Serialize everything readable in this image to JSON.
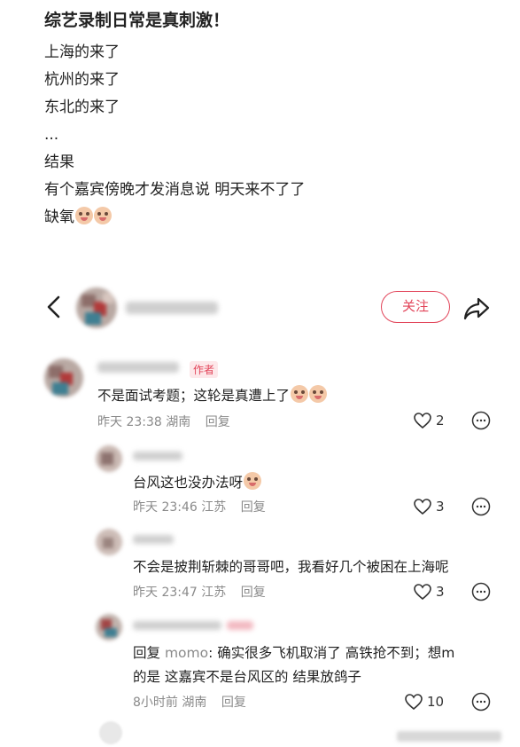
{
  "post": {
    "title": "综艺录制日常是真刺激！",
    "lines": [
      "上海的来了",
      "杭州的来了",
      "东北的来了",
      "...",
      "结果",
      "有个嘉宾傍晚才发消息说 明天来不了了",
      "缺氧"
    ]
  },
  "author_bar": {
    "follow_label": "关注"
  },
  "comments": [
    {
      "author_tag": "作者",
      "text": "不是面试考题；这轮是真遭上了",
      "time": "昨天 23:38",
      "location": "湖南",
      "reply": "回复",
      "likes": "2"
    },
    {
      "text": "台风这也没办法呀",
      "time": "昨天 23:46",
      "location": "江苏",
      "reply": "回复",
      "likes": "3"
    },
    {
      "text": "不会是披荆斩棘的哥哥吧，我看好几个被困在上海呢",
      "time": "昨天 23:47",
      "location": "江苏",
      "reply": "回复",
      "likes": "3"
    },
    {
      "reply_prefix": "回复",
      "mention": "momo",
      "text_line1": ": 确实很多飞机取消了 高铁抢不到；想m",
      "text_line2": "的是 这嘉宾不是台风区的 结果放鸽子",
      "time": "8小时前",
      "location": "湖南",
      "reply": "回复",
      "likes": "10"
    }
  ],
  "colors": {
    "accent": "#e2455a",
    "meta": "#8a8a8a",
    "text": "#222222"
  }
}
